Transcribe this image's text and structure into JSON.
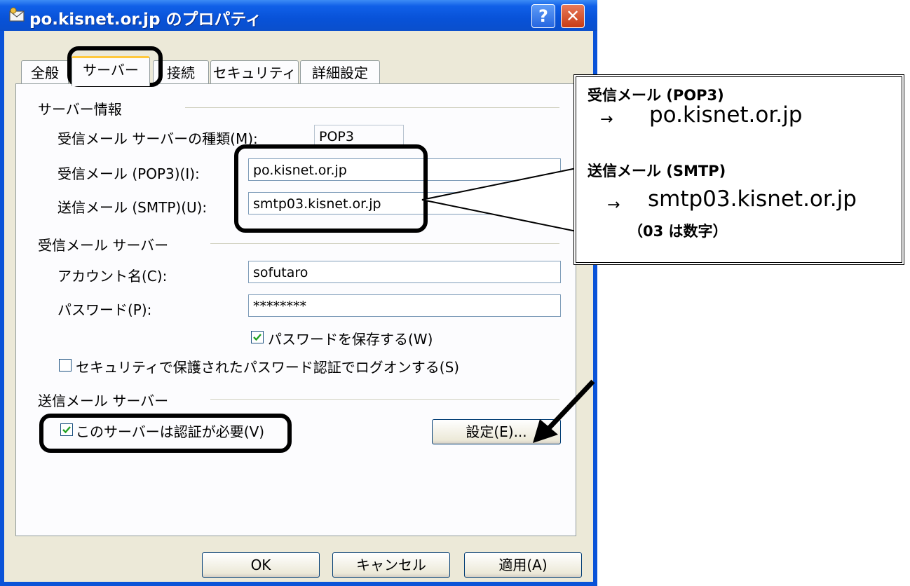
{
  "window": {
    "title": "po.kisnet.or.jp のプロパティ",
    "help_label": "?",
    "close_label": "✕"
  },
  "tabs": [
    {
      "label": "全般",
      "active": false
    },
    {
      "label": "サーバー",
      "active": true
    },
    {
      "label": "接続",
      "active": false
    },
    {
      "label": "セキュリティ",
      "active": false
    },
    {
      "label": "詳細設定",
      "active": false
    }
  ],
  "server_info": {
    "group_label": "サーバー情報",
    "type_label": "受信メール サーバーの種類(M):",
    "type_value": "POP3",
    "incoming_label": "受信メール (POP3)(I):",
    "incoming_value": "po.kisnet.or.jp",
    "outgoing_label": "送信メール (SMTP)(U):",
    "outgoing_value": "smtp03.kisnet.or.jp"
  },
  "incoming_server": {
    "group_label": "受信メール サーバー",
    "account_label": "アカウント名(C):",
    "account_value": "sofutaro",
    "password_label": "パスワード(P):",
    "password_value": "********",
    "save_password_label": "パスワードを保存する(W)",
    "save_password_checked": true,
    "spa_label": "セキュリティで保護されたパスワード認証でログオンする(S)",
    "spa_checked": false
  },
  "outgoing_server": {
    "group_label": "送信メール サーバー",
    "auth_label": "このサーバーは認証が必要(V)",
    "auth_checked": true,
    "settings_button": "設定(E)..."
  },
  "buttons": {
    "ok": "OK",
    "cancel": "キャンセル",
    "apply": "適用(A)"
  },
  "callout": {
    "incoming_heading": "受信メール (POP3)",
    "incoming_arrow": "→",
    "incoming_value": "po.kisnet.or.jp",
    "outgoing_heading": "送信メール (SMTP)",
    "outgoing_arrow": "→",
    "outgoing_value": "smtp03.kisnet.or.jp",
    "outgoing_note": "（03 は数字）"
  }
}
